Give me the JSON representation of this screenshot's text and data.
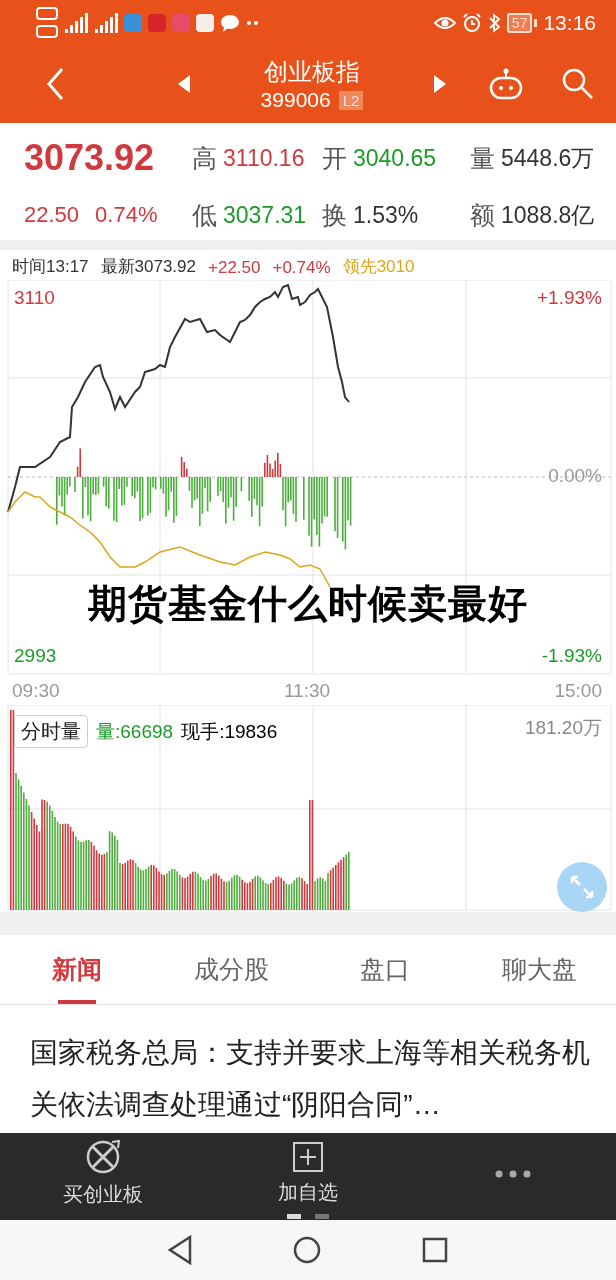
{
  "status_bar": {
    "time": "13:16",
    "battery": "57"
  },
  "header": {
    "title": "创业板指",
    "code": "399006",
    "badge": "L2"
  },
  "quote": {
    "price": "3073.92",
    "change": "22.50",
    "change_pct": "0.74%",
    "fields": [
      {
        "label": "高",
        "value": "3110.16",
        "color": "#d0393e"
      },
      {
        "label": "开",
        "value": "3040.65",
        "color": "#1e9a2a"
      },
      {
        "label": "量",
        "value": "5448.6万",
        "color": "#333333"
      },
      {
        "label": "低",
        "value": "3037.31",
        "color": "#1e9a2a"
      },
      {
        "label": "换",
        "value": "1.53%",
        "color": "#333333"
      },
      {
        "label": "额",
        "value": "1088.8亿",
        "color": "#333333"
      }
    ]
  },
  "chart_info": [
    {
      "text": "时间13:17",
      "color": "#333333"
    },
    {
      "text": "最新3073.92",
      "color": "#333333"
    },
    {
      "text": "+22.50",
      "color": "#d0393e"
    },
    {
      "text": "+0.74%",
      "color": "#d0393e"
    },
    {
      "text": "领先3010",
      "color": "#d9a61a"
    }
  ],
  "price_chart": {
    "high": "3110",
    "low": "2993",
    "high_pct": "+1.93%",
    "zero_pct": "0.00%",
    "low_pct": "-1.93%",
    "times": [
      "09:30",
      "11:30",
      "15:00"
    ]
  },
  "volume_chart": {
    "button": "分时量",
    "volume": "量:66698",
    "hand": "现手:19836",
    "max": "181.20万"
  },
  "overlay_caption": "期货基金什么时候卖最好",
  "tabs": [
    {
      "label": "新闻",
      "selected": true
    },
    {
      "label": "成分股",
      "selected": false
    },
    {
      "label": "盘口",
      "selected": false
    },
    {
      "label": "聊大盘",
      "selected": false
    }
  ],
  "news": {
    "headline": "国家税务总局：支持并要求上海等相关税务机关依法调查处理通过“阴阳合同”…"
  },
  "toolbar": [
    {
      "kind": "buy",
      "label": "买创业板"
    },
    {
      "kind": "add",
      "label": "加自选"
    },
    {
      "kind": "more"
    }
  ]
}
